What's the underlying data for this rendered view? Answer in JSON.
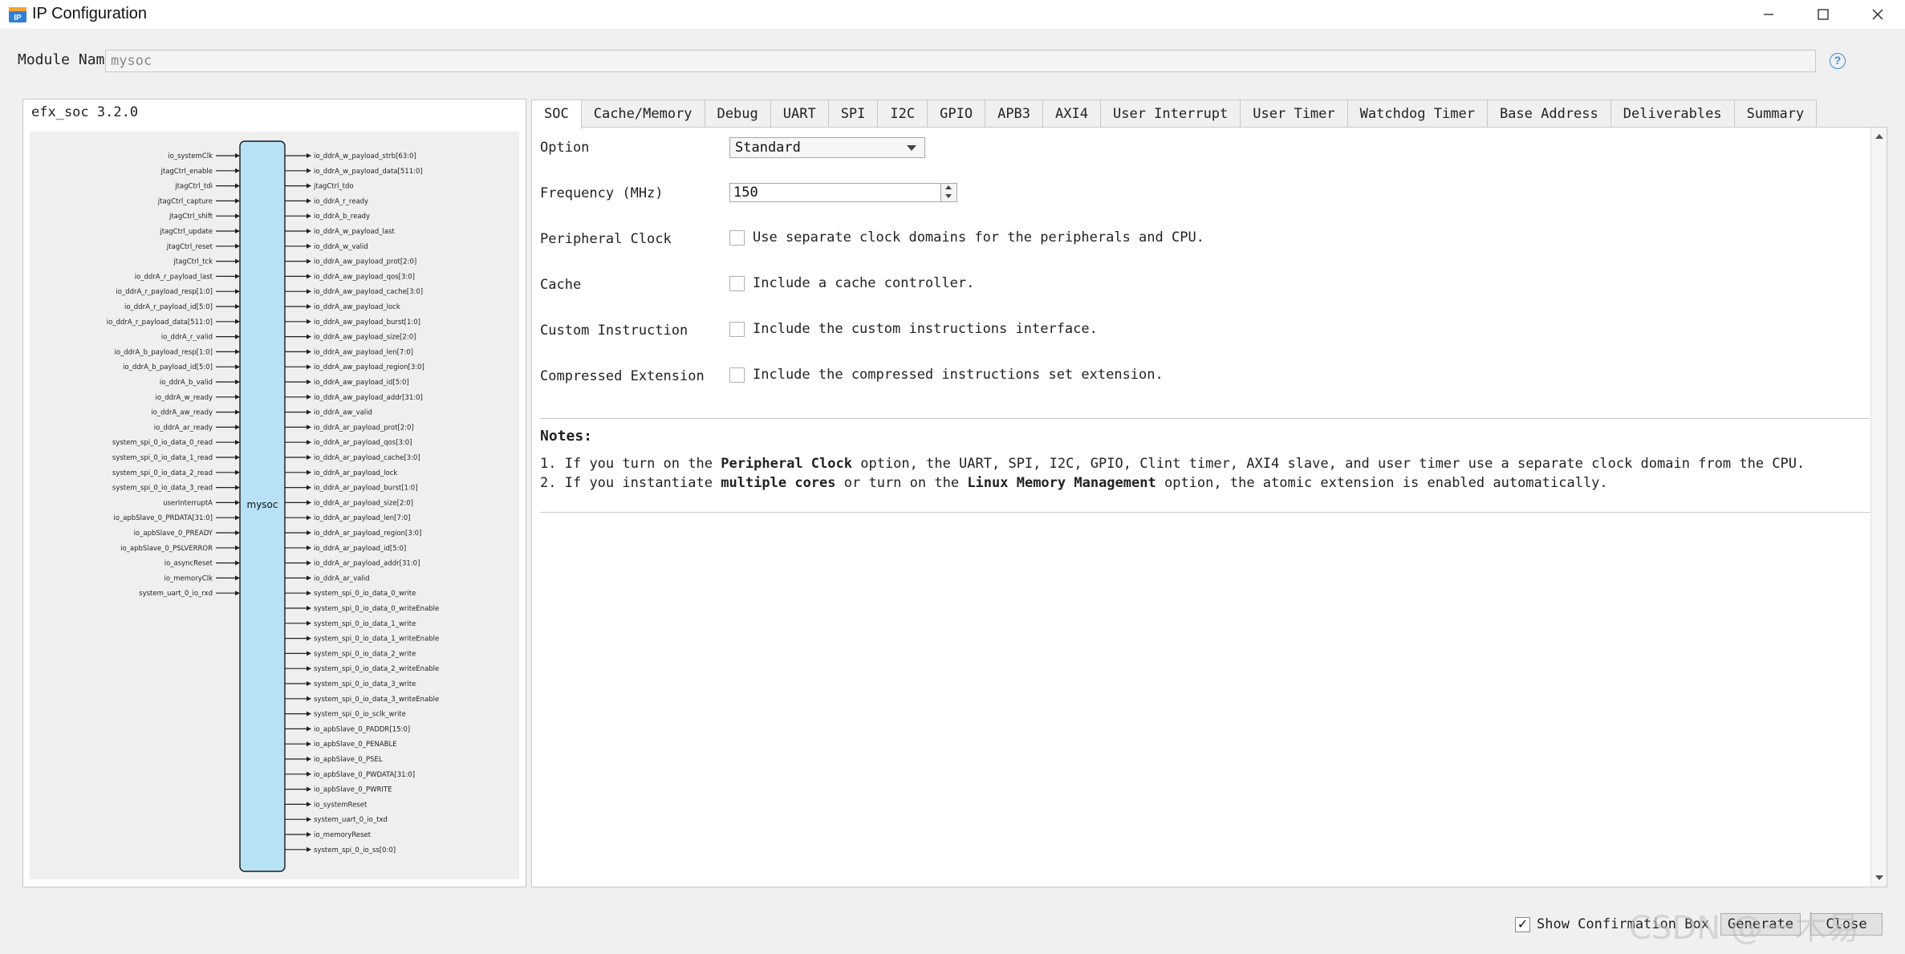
{
  "window": {
    "title": "IP Configuration",
    "icon": "ip-app-icon",
    "controls": [
      "minimize-icon",
      "maximize-icon",
      "close-icon"
    ]
  },
  "module": {
    "label": "Module Nam",
    "value": "mysoc",
    "help_icon": "?"
  },
  "diagram": {
    "ip_version": "efx_soc 3.2.0",
    "block_name": "mysoc",
    "colors": {
      "block_fill": "#b7e2f6",
      "block_stroke": "#1a1a1a"
    },
    "inputs": [
      "io_systemClk",
      "jtagCtrl_enable",
      "jtagCtrl_tdi",
      "jtagCtrl_capture",
      "jtagCtrl_shift",
      "jtagCtrl_update",
      "jtagCtrl_reset",
      "jtagCtrl_tck",
      "io_ddrA_r_payload_last",
      "io_ddrA_r_payload_resp[1:0]",
      "io_ddrA_r_payload_id[5:0]",
      "io_ddrA_r_payload_data[511:0]",
      "io_ddrA_r_valid",
      "io_ddrA_b_payload_resp[1:0]",
      "io_ddrA_b_payload_id[5:0]",
      "io_ddrA_b_valid",
      "io_ddrA_w_ready",
      "io_ddrA_aw_ready",
      "io_ddrA_ar_ready",
      "system_spi_0_io_data_0_read",
      "system_spi_0_io_data_1_read",
      "system_spi_0_io_data_2_read",
      "system_spi_0_io_data_3_read",
      "userInterruptA",
      "io_apbSlave_0_PRDATA[31:0]",
      "io_apbSlave_0_PREADY",
      "io_apbSlave_0_PSLVERROR",
      "io_asyncReset",
      "io_memoryClk",
      "system_uart_0_io_rxd"
    ],
    "outputs": [
      "io_ddrA_w_payload_strb[63:0]",
      "io_ddrA_w_payload_data[511:0]",
      "jtagCtrl_tdo",
      "io_ddrA_r_ready",
      "io_ddrA_b_ready",
      "io_ddrA_w_payload_last",
      "io_ddrA_w_valid",
      "io_ddrA_aw_payload_prot[2:0]",
      "io_ddrA_aw_payload_qos[3:0]",
      "io_ddrA_aw_payload_cache[3:0]",
      "io_ddrA_aw_payload_lock",
      "io_ddrA_aw_payload_burst[1:0]",
      "io_ddrA_aw_payload_size[2:0]",
      "io_ddrA_aw_payload_len[7:0]",
      "io_ddrA_aw_payload_region[3:0]",
      "io_ddrA_aw_payload_id[5:0]",
      "io_ddrA_aw_payload_addr[31:0]",
      "io_ddrA_aw_valid",
      "io_ddrA_ar_payload_prot[2:0]",
      "io_ddrA_ar_payload_qos[3:0]",
      "io_ddrA_ar_payload_cache[3:0]",
      "io_ddrA_ar_payload_lock",
      "io_ddrA_ar_payload_burst[1:0]",
      "io_ddrA_ar_payload_size[2:0]",
      "io_ddrA_ar_payload_len[7:0]",
      "io_ddrA_ar_payload_region[3:0]",
      "io_ddrA_ar_payload_id[5:0]",
      "io_ddrA_ar_payload_addr[31:0]",
      "io_ddrA_ar_valid",
      "system_spi_0_io_data_0_write",
      "system_spi_0_io_data_0_writeEnable",
      "system_spi_0_io_data_1_write",
      "system_spi_0_io_data_1_writeEnable",
      "system_spi_0_io_data_2_write",
      "system_spi_0_io_data_2_writeEnable",
      "system_spi_0_io_data_3_write",
      "system_spi_0_io_data_3_writeEnable",
      "system_spi_0_io_sclk_write",
      "io_apbSlave_0_PADDR[15:0]",
      "io_apbSlave_0_PENABLE",
      "io_apbSlave_0_PSEL",
      "io_apbSlave_0_PWDATA[31:0]",
      "io_apbSlave_0_PWRITE",
      "io_systemReset",
      "system_uart_0_io_txd",
      "io_memoryReset",
      "system_spi_0_io_ss[0:0]"
    ]
  },
  "tabs": [
    {
      "label": "SOC",
      "active": true
    },
    {
      "label": "Cache/Memory"
    },
    {
      "label": "Debug"
    },
    {
      "label": "UART"
    },
    {
      "label": "SPI"
    },
    {
      "label": "I2C"
    },
    {
      "label": "GPIO"
    },
    {
      "label": "APB3"
    },
    {
      "label": "AXI4"
    },
    {
      "label": "User Interrupt"
    },
    {
      "label": "User Timer"
    },
    {
      "label": "Watchdog Timer"
    },
    {
      "label": "Base Address"
    },
    {
      "label": "Deliverables"
    },
    {
      "label": "Summary"
    }
  ],
  "soc": {
    "option_label": "Option",
    "option_value": "Standard",
    "frequency_label": "Frequency (MHz)",
    "frequency_value": "150",
    "peripheral_clock_label": "Peripheral Clock",
    "peripheral_clock_text": "Use separate clock domains for the peripherals and CPU.",
    "cache_label": "Cache",
    "cache_text": "Include a cache controller.",
    "custom_instruction_label": "Custom Instruction",
    "custom_instruction_text": "Include the custom instructions interface.",
    "compressed_extension_label": "Compressed Extension",
    "compressed_extension_text": "Include the compressed instructions set extension."
  },
  "notes": {
    "title": "Notes:",
    "note1": {
      "num": "1.",
      "pre": "If you turn on the",
      "bold": "Peripheral Clock",
      "post": "option, the UART, SPI, I2C, GPIO, Clint timer, AXI4 slave, and user timer use a separate clock domain from the CPU."
    },
    "note2": {
      "num": "2.",
      "pre": "If you instantiate",
      "bold1": "multiple cores",
      "mid": "or turn on the",
      "bold2": "Linux Memory Management",
      "post": "option, the atomic extension is enabled automatically."
    }
  },
  "footer": {
    "show_confirmation_label": "Show Confirmation Box",
    "show_confirmation_checked": true,
    "checkmark": "✓",
    "generate_label": "Generate",
    "close_label": "Close",
    "watermark": "CSDN @一木易"
  }
}
